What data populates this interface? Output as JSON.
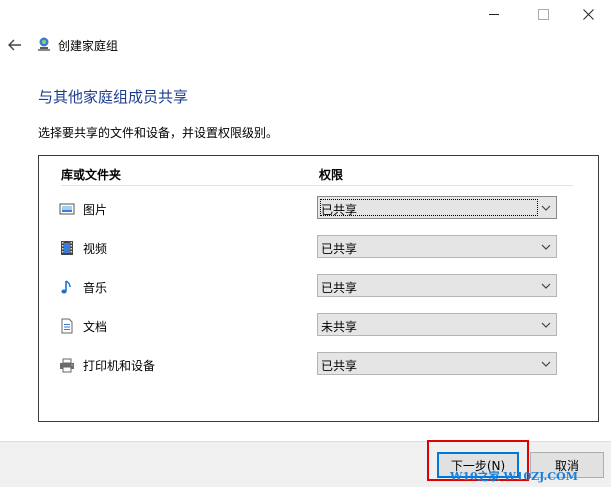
{
  "window": {
    "nav_title": "创建家庭组",
    "minimize_glyph": "—",
    "maximize_glyph": "☐",
    "close_glyph": "✕"
  },
  "main": {
    "heading": "与其他家庭组成员共享",
    "instruction": "选择要共享的文件和设备，并设置权限级别。",
    "columns": {
      "library": "库或文件夹",
      "permission": "权限"
    },
    "rows": [
      {
        "label": "图片",
        "icon": "pictures-icon",
        "permission": "已共享"
      },
      {
        "label": "视频",
        "icon": "videos-icon",
        "permission": "已共享"
      },
      {
        "label": "音乐",
        "icon": "music-icon",
        "permission": "已共享"
      },
      {
        "label": "文档",
        "icon": "documents-icon",
        "permission": "未共享"
      },
      {
        "label": "打印机和设备",
        "icon": "printer-icon",
        "permission": "已共享"
      }
    ]
  },
  "footer": {
    "next_label": "下一步(N)",
    "cancel_label": "取消",
    "watermark": "W10之家 W10ZJ.COM"
  }
}
